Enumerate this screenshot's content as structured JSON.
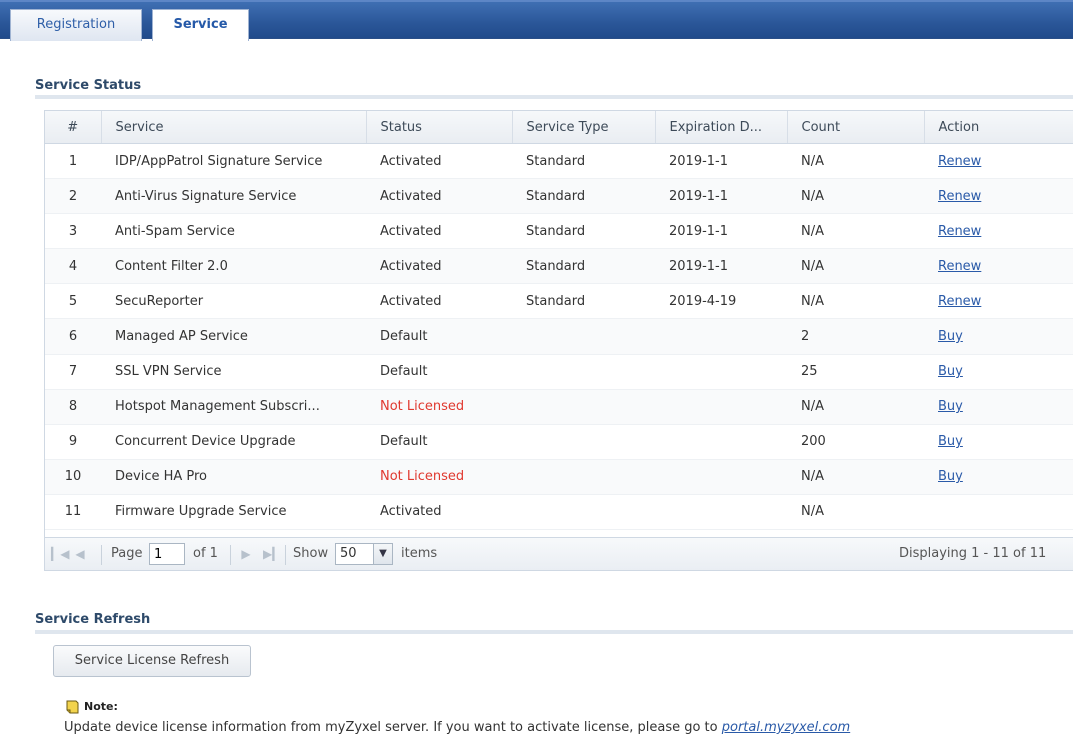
{
  "tabs": [
    {
      "label": "Registration",
      "active": false
    },
    {
      "label": "Service",
      "active": true
    }
  ],
  "service_status": {
    "title": "Service Status",
    "columns": [
      "#",
      "Service",
      "Status",
      "Service Type",
      "Expiration D...",
      "Count",
      "Action"
    ],
    "rows": [
      {
        "num": "1",
        "service": "IDP/AppPatrol Signature Service",
        "status": "Activated",
        "type": "Standard",
        "expiration": "2019-1-1",
        "count": "N/A",
        "action": "Renew"
      },
      {
        "num": "2",
        "service": "Anti-Virus Signature Service",
        "status": "Activated",
        "type": "Standard",
        "expiration": "2019-1-1",
        "count": "N/A",
        "action": "Renew"
      },
      {
        "num": "3",
        "service": "Anti-Spam Service",
        "status": "Activated",
        "type": "Standard",
        "expiration": "2019-1-1",
        "count": "N/A",
        "action": "Renew"
      },
      {
        "num": "4",
        "service": "Content Filter 2.0",
        "status": "Activated",
        "type": "Standard",
        "expiration": "2019-1-1",
        "count": "N/A",
        "action": "Renew"
      },
      {
        "num": "5",
        "service": "SecuReporter",
        "status": "Activated",
        "type": "Standard",
        "expiration": "2019-4-19",
        "count": "N/A",
        "action": "Renew"
      },
      {
        "num": "6",
        "service": "Managed AP Service",
        "status": "Default",
        "type": "",
        "expiration": "",
        "count": "2",
        "action": "Buy"
      },
      {
        "num": "7",
        "service": "SSL VPN Service",
        "status": "Default",
        "type": "",
        "expiration": "",
        "count": "25",
        "action": "Buy"
      },
      {
        "num": "8",
        "service": "Hotspot Management Subscri...",
        "status": "Not Licensed",
        "type": "",
        "expiration": "",
        "count": "N/A",
        "action": "Buy"
      },
      {
        "num": "9",
        "service": "Concurrent Device Upgrade",
        "status": "Default",
        "type": "",
        "expiration": "",
        "count": "200",
        "action": "Buy"
      },
      {
        "num": "10",
        "service": "Device HA Pro",
        "status": "Not Licensed",
        "type": "",
        "expiration": "",
        "count": "N/A",
        "action": "Buy"
      },
      {
        "num": "11",
        "service": "Firmware Upgrade Service",
        "status": "Activated",
        "type": "",
        "expiration": "",
        "count": "N/A",
        "action": ""
      }
    ],
    "pager": {
      "page_label": "Page",
      "page_value": "1",
      "of_label": "of 1",
      "show_label": "Show",
      "show_value": "50",
      "items_label": "items",
      "display_text": "Displaying 1 - 11 of 11"
    }
  },
  "service_refresh": {
    "title": "Service Refresh",
    "button_label": "Service License Refresh"
  },
  "note": {
    "label": "Note:",
    "text": "Update device license information from myZyxel server. If you want to activate license, please go to ",
    "link": "portal.myzyxel.com"
  },
  "colors": {
    "tabbar": "#2a5698",
    "not_licensed": "#e0392f",
    "link": "#2a5aa8"
  }
}
